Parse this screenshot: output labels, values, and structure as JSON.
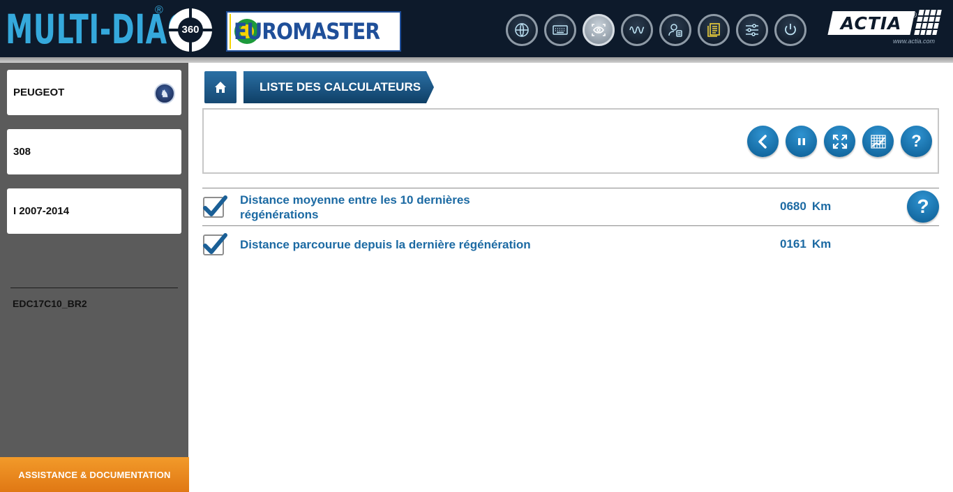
{
  "header": {
    "app_name": "MULTI-DIAG",
    "app_reg": "®",
    "badge": "360",
    "partner": "EUROMASTER",
    "brand": "ACTIA",
    "brand_reg": "®",
    "brand_url": "www.actia.com",
    "tools": [
      {
        "icon": "globe-www-icon"
      },
      {
        "icon": "keyboard-icon"
      },
      {
        "icon": "eye-scan-icon",
        "active": true
      },
      {
        "icon": "waveform-icon"
      },
      {
        "icon": "user-profile-icon"
      },
      {
        "icon": "documents-icon"
      },
      {
        "icon": "settings-sliders-icon"
      },
      {
        "icon": "power-icon"
      }
    ]
  },
  "sidebar": {
    "make": "PEUGEOT",
    "model": "308",
    "generation": "I 2007-2014",
    "ecu": "EDC17C10_BR2",
    "assist_label": "ASSISTANCE & DOCUMENTATION"
  },
  "main": {
    "breadcrumb": "LISTE DES CALCULATEURS",
    "toolbar": {
      "buttons": [
        "back-icon",
        "pause-icon",
        "fullscreen-icon",
        "graph-icon",
        "help-icon"
      ],
      "help_glyph": "?"
    },
    "rows": [
      {
        "label": "Distance moyenne entre les 10 dernières régénérations",
        "value": "0680",
        "unit": "Km",
        "checked": true
      },
      {
        "label": "Distance parcourue depuis la dernière régénération",
        "value": "0161",
        "unit": "Km",
        "checked": true
      }
    ],
    "row_help_glyph": "?"
  },
  "colors": {
    "header_bg": "#0d1a2b",
    "logo_blue": "#35a9dc",
    "sidebar_bg": "#5b5b5b",
    "accent_orange": "#e88620",
    "value_blue": "#1c6aa3",
    "button_blue": "#1a78b6"
  }
}
